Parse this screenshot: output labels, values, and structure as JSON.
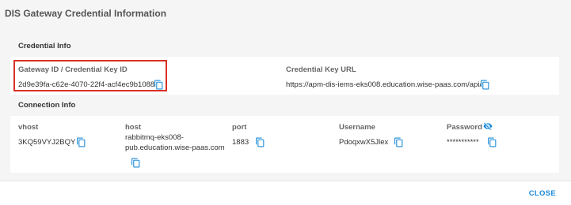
{
  "dialog": {
    "title": "DIS Gateway Credential Information",
    "close_label": "CLOSE"
  },
  "credential_info": {
    "header": "Credential Info",
    "gateway_id_label": "Gateway ID / Credential Key ID",
    "gateway_id_value": "2d9e39fa-c62e-4070-22f4-acf4ec9b1088",
    "key_url_label": "Credential Key URL",
    "key_url_value": "https://apm-dis-iems-eks008.education.wise-paas.com/api/"
  },
  "connection_info": {
    "header": "Connection Info",
    "vhost_label": "vhost",
    "vhost_value": "3KQ59VYJ2BQY",
    "host_label": "host",
    "host_value_line1": "rabbitmq-eks008-",
    "host_value_line2": "pub.education.wise-paas.com",
    "port_label": "port",
    "port_value": "1883",
    "username_label": "Username",
    "username_value": "PdoqxwX5Jlex",
    "password_label": "Password",
    "password_value": "***********"
  },
  "icons": {
    "copy": "copy-icon",
    "visibility": "eye-off-icon"
  },
  "colors": {
    "accent": "#1b8bd9",
    "highlight": "#d93025"
  }
}
